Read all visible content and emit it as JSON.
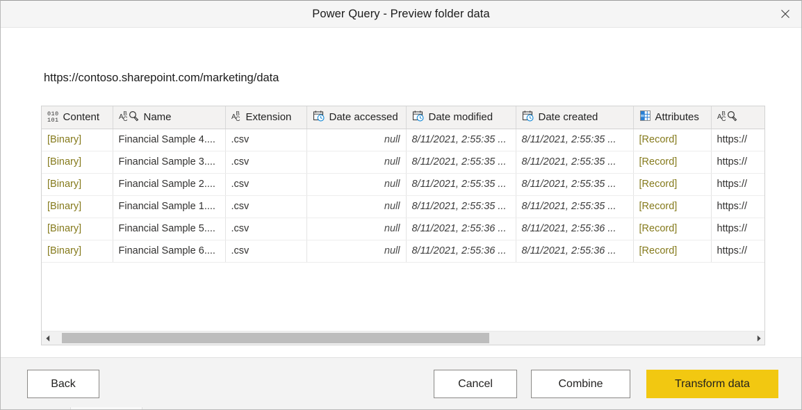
{
  "window": {
    "title": "Power Query - Preview folder data",
    "close_icon": "close-icon"
  },
  "path": {
    "url": "https://contoso.sharepoint.com/marketing/data"
  },
  "grid": {
    "columns": [
      {
        "label": "Content",
        "icon": "binary-type-icon",
        "align": "left"
      },
      {
        "label": "Name",
        "icon": "text-type-search-icon",
        "align": "left"
      },
      {
        "label": "Extension",
        "icon": "text-type-icon",
        "align": "left"
      },
      {
        "label": "Date accessed",
        "icon": "datetime-type-icon",
        "align": "right"
      },
      {
        "label": "Date modified",
        "icon": "datetime-type-icon",
        "align": "left"
      },
      {
        "label": "Date created",
        "icon": "datetime-type-icon",
        "align": "left"
      },
      {
        "label": "Attributes",
        "icon": "record-type-icon",
        "align": "left"
      },
      {
        "label": "",
        "icon": "text-type-search-icon",
        "align": "left"
      }
    ],
    "rows": [
      {
        "content": "[Binary]",
        "name": "Financial Sample 4....",
        "extension": ".csv",
        "date_accessed": "null",
        "date_modified": "8/11/2021, 2:55:35 ...",
        "date_created": "8/11/2021, 2:55:35 ...",
        "attributes": "[Record]",
        "folder_path": "https://"
      },
      {
        "content": "[Binary]",
        "name": "Financial Sample 3....",
        "extension": ".csv",
        "date_accessed": "null",
        "date_modified": "8/11/2021, 2:55:35 ...",
        "date_created": "8/11/2021, 2:55:35 ...",
        "attributes": "[Record]",
        "folder_path": "https://"
      },
      {
        "content": "[Binary]",
        "name": "Financial Sample 2....",
        "extension": ".csv",
        "date_accessed": "null",
        "date_modified": "8/11/2021, 2:55:35 ...",
        "date_created": "8/11/2021, 2:55:35 ...",
        "attributes": "[Record]",
        "folder_path": "https://"
      },
      {
        "content": "[Binary]",
        "name": "Financial Sample 1....",
        "extension": ".csv",
        "date_accessed": "null",
        "date_modified": "8/11/2021, 2:55:35 ...",
        "date_created": "8/11/2021, 2:55:35 ...",
        "attributes": "[Record]",
        "folder_path": "https://"
      },
      {
        "content": "[Binary]",
        "name": "Financial Sample 5....",
        "extension": ".csv",
        "date_accessed": "null",
        "date_modified": "8/11/2021, 2:55:36 ...",
        "date_created": "8/11/2021, 2:55:36 ...",
        "attributes": "[Record]",
        "folder_path": "https://"
      },
      {
        "content": "[Binary]",
        "name": "Financial Sample 6....",
        "extension": ".csv",
        "date_accessed": "null",
        "date_modified": "8/11/2021, 2:55:36 ...",
        "date_created": "8/11/2021, 2:55:36 ...",
        "attributes": "[Record]",
        "folder_path": "https://"
      }
    ]
  },
  "scrollbar": {
    "left_arrow_icon": "chevron-left-icon",
    "right_arrow_icon": "chevron-right-icon"
  },
  "footer": {
    "back_label": "Back",
    "cancel_label": "Cancel",
    "combine_label": "Combine",
    "transform_label": "Transform data"
  },
  "colors": {
    "primary_button": "#f2c811",
    "structured_value": "#857a1c",
    "header_background": "#f3f2f1",
    "footer_background": "#f3f3f3"
  }
}
